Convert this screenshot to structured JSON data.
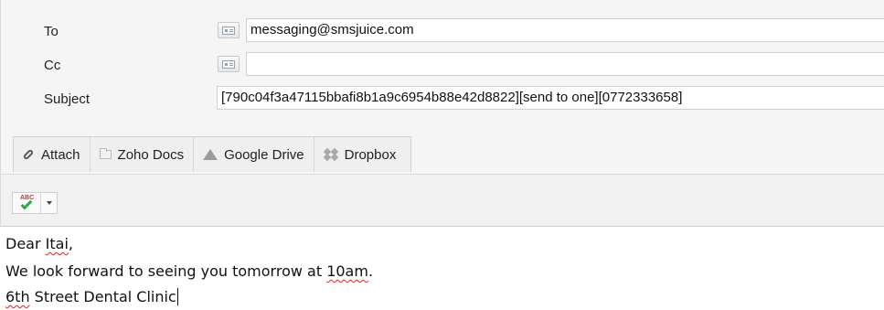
{
  "header": {
    "to": {
      "label": "To",
      "value": "messaging@smsjuice.com"
    },
    "cc": {
      "label": "Cc",
      "value": ""
    },
    "subject": {
      "label": "Subject",
      "value": "[790c04f3a47115bbafi8b1a9c6954b88e42d8822][send to one][0772333658]"
    }
  },
  "attachments": {
    "buttons": [
      {
        "label": "Attach",
        "icon": "paperclip-icon"
      },
      {
        "label": "Zoho Docs",
        "icon": "folder-icon"
      },
      {
        "label": "Google Drive",
        "icon": "google-drive-icon"
      },
      {
        "label": "Dropbox",
        "icon": "dropbox-icon"
      }
    ]
  },
  "spellcheck": {
    "icon_text": "ABC"
  },
  "body": {
    "line1": {
      "pre": "Dear ",
      "misspelled": "Itai",
      "post": ","
    },
    "line2": {
      "pre": "We look forward to seeing you tomorrow at ",
      "misspelled": "10am",
      "post": "."
    },
    "line3": {
      "misspelled": "6th",
      "post": " Street Dental Clinic"
    }
  }
}
